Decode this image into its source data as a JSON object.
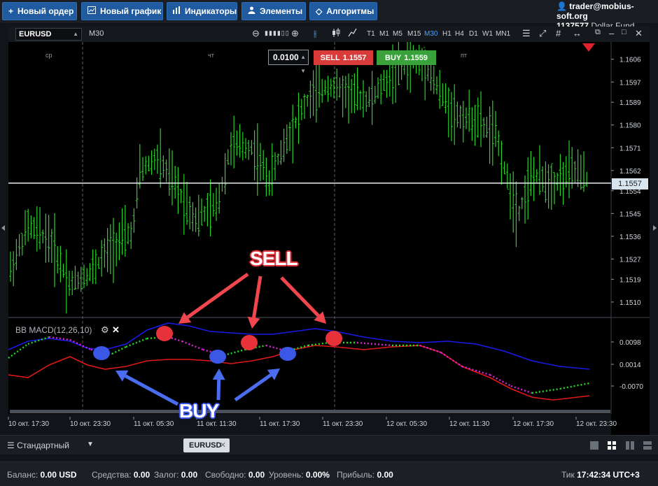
{
  "toolbar": {
    "new_order": "Новый ордер",
    "new_chart": "Новый график",
    "indicators": "Индикаторы",
    "elements": "Элементы",
    "algorithms": "Алгоритмы"
  },
  "account": {
    "email": "trader@mobius-soft.org",
    "id": "1137577",
    "fund": "Dollar Fund"
  },
  "chart_toolbar": {
    "symbol": "EURUSD",
    "timeframe": "M30",
    "timeframes": [
      "T1",
      "M1",
      "M5",
      "M15",
      "M30",
      "H1",
      "H4",
      "D1",
      "W1",
      "MN1"
    ],
    "active_timeframe": "M30"
  },
  "trade": {
    "lot": "0.0100",
    "sell_label": "SELL",
    "sell_price": "1.1557",
    "buy_label": "BUY",
    "buy_price": "1.1559"
  },
  "chart_data": {
    "type": "candlestick",
    "day_labels": [
      {
        "label": "ср",
        "x": 0.5
      },
      {
        "label": "чт",
        "x": 26
      },
      {
        "label": "пт",
        "x": 58
      }
    ],
    "price_axis": [
      "1.1606",
      "1.1597",
      "1.1589",
      "1.1580",
      "1.1571",
      "1.1562",
      "1.1554",
      "1.1545",
      "1.1536",
      "1.1527",
      "1.1519",
      "1.1510"
    ],
    "ylim": [
      1.1505,
      1.1612
    ],
    "current_price": "1.1557",
    "time_axis": [
      "10 окт. 17:30",
      "10 окт. 23:30",
      "11 окт. 05:30",
      "11 окт. 11:30",
      "11 окт. 17:30",
      "11 окт. 23:30",
      "12 окт. 05:30",
      "12 окт. 11:30",
      "12 окт. 17:30",
      "12 окт. 23:30"
    ],
    "indicator": {
      "name": "BB MACD(12,26,10)",
      "axis": [
        "0.0098",
        "0.0014",
        "-0.0070"
      ]
    }
  },
  "annotations": {
    "sell": "SELL",
    "buy": "BUY"
  },
  "tabs": {
    "layout": "Стандартный",
    "chart_tab": "EURUSD"
  },
  "status": {
    "balance_label": "Баланс:",
    "balance_value": "0.00",
    "balance_currency": "USD",
    "funds_label": "Средства:",
    "funds_value": "0.00",
    "margin_label": "Залог:",
    "margin_value": "0.00",
    "free_label": "Свободно:",
    "free_value": "0.00",
    "level_label": "Уровень:",
    "level_value": "0.00%",
    "profit_label": "Прибыль:",
    "profit_value": "0.00",
    "tick_label": "Тик",
    "tick_time": "17:42:34",
    "timezone": "UTC+3"
  },
  "colors": {
    "bull": "#2bd02b",
    "sell": "#d93b3b",
    "buy": "#3aa23a",
    "macd_upper": "#1a1ae6",
    "macd_lower": "#e01818",
    "accent": "#1f5b9e"
  }
}
